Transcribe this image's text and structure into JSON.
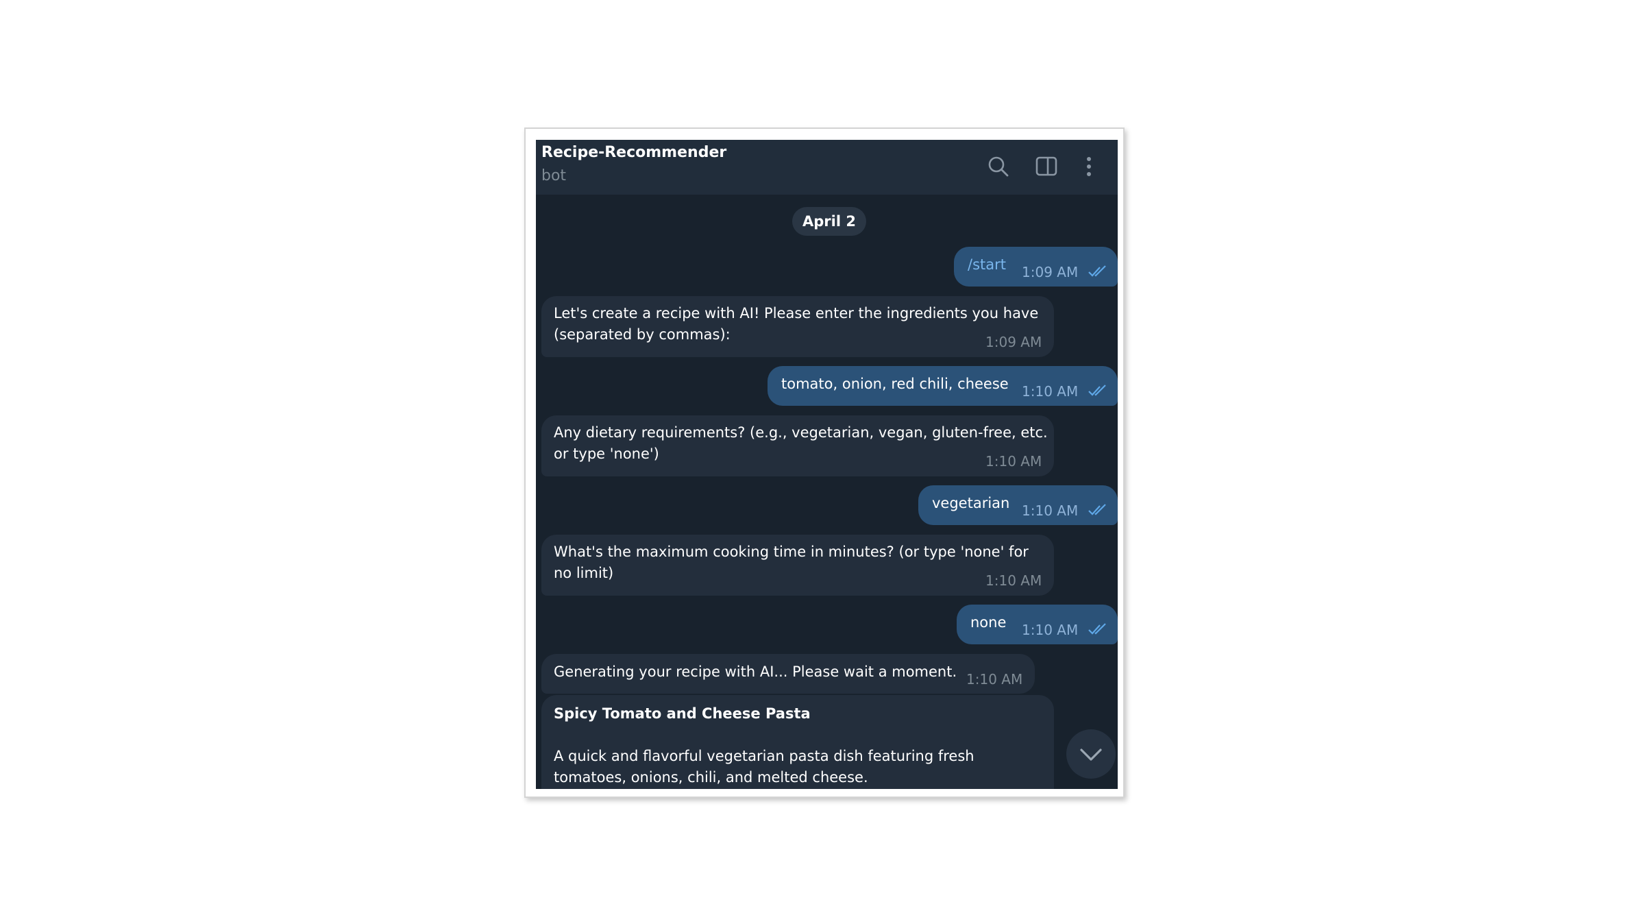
{
  "chat": {
    "title": "Recipe-Recommender",
    "subtitle": "bot"
  },
  "header_icons": [
    "search-icon",
    "sidebar-toggle-icon",
    "more-vertical-icon"
  ],
  "date_separator": "April 2",
  "messages": [
    {
      "direction": "out",
      "text": "/start",
      "time": "1:09 AM",
      "status": "read"
    },
    {
      "direction": "in",
      "text": "Let's create a recipe with AI! Please enter the ingredients you have\n(separated by commas):",
      "time": "1:09 AM"
    },
    {
      "direction": "out",
      "text": "tomato, onion, red chili, cheese",
      "time": "1:10 AM",
      "status": "read"
    },
    {
      "direction": "in",
      "text": "Any dietary requirements? (e.g., vegetarian, vegan, gluten-free, etc.\nor type 'none')",
      "time": "1:10 AM"
    },
    {
      "direction": "out",
      "text": "vegetarian",
      "time": "1:10 AM",
      "status": "read"
    },
    {
      "direction": "in",
      "text": "What's the maximum cooking time in minutes? (or type 'none' for\nno limit)",
      "time": "1:10 AM"
    },
    {
      "direction": "out",
      "text": "none",
      "time": "1:10 AM",
      "status": "read"
    },
    {
      "direction": "in",
      "text": "Generating your recipe with AI... Please wait a moment.",
      "time": "1:10 AM"
    },
    {
      "direction": "in",
      "title": "Spicy Tomato and Cheese Pasta",
      "text": "A quick and flavorful vegetarian pasta dish featuring fresh\ntomatoes, onions, chili, and melted cheese."
    }
  ],
  "colors": {
    "background": "#18222d",
    "header": "#212d3b",
    "incoming_bubble": "#232e3c",
    "outgoing_bubble": "#2b5278",
    "command_link": "#7ab6ec",
    "read_ticks": "#5fa8e8"
  }
}
